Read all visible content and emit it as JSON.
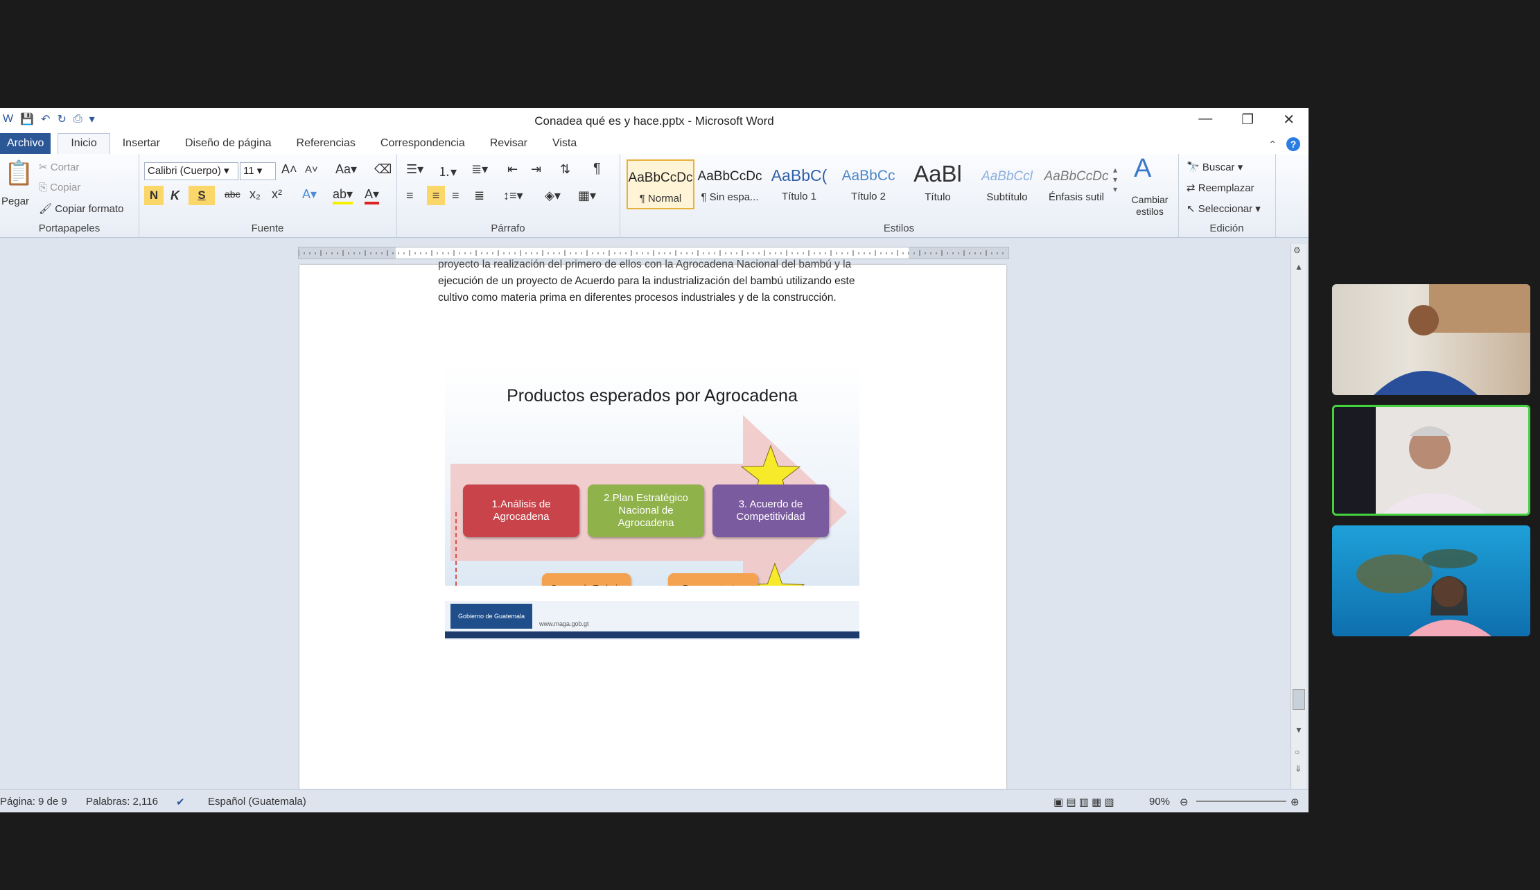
{
  "window": {
    "title": "Conadea qué es y hace.pptx  -  Microsoft Word"
  },
  "tabs": [
    "Archivo",
    "Inicio",
    "Insertar",
    "Diseño de página",
    "Referencias",
    "Correspondencia",
    "Revisar",
    "Vista"
  ],
  "ribbon": {
    "clipboard": {
      "paste": "Pegar",
      "cut": "Cortar",
      "copy": "Copiar",
      "format_painter": "Copiar formato",
      "label": "Portapapeles"
    },
    "font": {
      "name": "Calibri (Cuerpo)",
      "size": "11",
      "label": "Fuente",
      "bold": "N",
      "italic": "K",
      "underline": "S",
      "strike": "abc"
    },
    "paragraph": {
      "label": "Párrafo"
    },
    "styles": {
      "label": "Estilos",
      "items": [
        {
          "sample": "AaBbCcDc",
          "name": "¶ Normal"
        },
        {
          "sample": "AaBbCcDc",
          "name": "¶ Sin espa..."
        },
        {
          "sample": "AaBbC(",
          "name": "Título 1"
        },
        {
          "sample": "AaBbCc",
          "name": "Título 2"
        },
        {
          "sample": "AaBl",
          "name": "Título"
        },
        {
          "sample": "AaBbCcl",
          "name": "Subtítulo"
        },
        {
          "sample": "AaBbCcDc",
          "name": "Énfasis sutil"
        }
      ],
      "change_styles": "Cambiar estilos"
    },
    "editing": {
      "find": "Buscar",
      "replace": "Reemplazar",
      "select": "Seleccionar",
      "label": "Edición"
    }
  },
  "document": {
    "para_line1": "proyecto la realización del primero de ellos con la Agrocadena Nacional del bambú y la",
    "para_line2": "ejecución de un proyecto de Acuerdo para la industrialización del bambú utilizando este",
    "para_line3": "cultivo como     materia prima en diferentes procesos industriales y de la construcción.",
    "slide": {
      "title": "Productos esperados por Agrocadena",
      "card1": "1.Análisis de Agrocadena",
      "card2": "2.Plan Estratégico Nacional de Agrocadena",
      "card3": "3. Acuerdo de Competitividad",
      "card4": "Grupos de Trabajo Agrocadena Conformados",
      "card5": "Representantes Ante Consejo Electos",
      "logo": "Gobierno de Guatemala",
      "url": "www.maga.gob.gt"
    }
  },
  "status": {
    "page": "Página: 9 de 9",
    "words": "Palabras: 2,116",
    "language": "Español (Guatemala)",
    "zoom": "90%"
  },
  "colors": {
    "card1": "#c8444a",
    "card2": "#8fb24a",
    "card3": "#7b5ba0",
    "card_orange": "#f4a24f",
    "star": "#f6ea2a",
    "active_speaker": "#45d23f"
  }
}
